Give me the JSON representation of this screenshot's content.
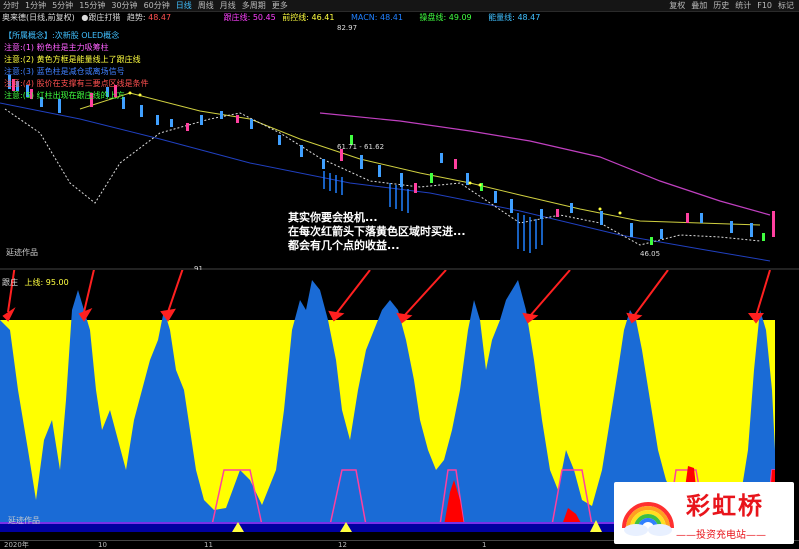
{
  "toolbar": {
    "items": [
      "分时",
      "1分钟",
      "5分钟",
      "15分钟",
      "30分钟",
      "60分钟",
      "日线",
      "周线",
      "月线",
      "多周期",
      "更多"
    ],
    "active": "日线",
    "right": [
      "复权",
      "叠加",
      "历史",
      "统计",
      "F10",
      "标记"
    ]
  },
  "status": {
    "stock": "奥来德(日线,前复权)",
    "follow": "●跟庄打猎",
    "trend_label": "趋势:",
    "trend_value": "48.47",
    "ma_label": "跟庄线:",
    "ma_value": "50.45",
    "pre_label": "前控线:",
    "pre_value": "46.41",
    "macn_label": "MACN:",
    "macn_value": "48.41",
    "kong_label": "操盘线:",
    "kong_value": "49.09",
    "nl_label": "能量线:",
    "nl_value": "48.47"
  },
  "legend": [
    {
      "text": "【所属概念】:次新股 OLED概念",
      "color": "#40c0ff"
    },
    {
      "text": "注意:(1)    粉色柱是主力吸筹柱",
      "color": "#ff60ff"
    },
    {
      "text": "注意:(2)    黄色方框是能量线上了跟庄线",
      "color": "#ffff40"
    },
    {
      "text": "注意:(3)    蓝色柱是减仓或离场信号",
      "color": "#4080ff"
    },
    {
      "text": "注意:(4)    股价在支撑有三要点区线是条件",
      "color": "#ff5050"
    },
    {
      "text": "注意:(5)    红柱出现在跟庄线的上方",
      "color": "#40ff40"
    }
  ],
  "caption": [
    "其实你要会投机...",
    "在每次红箭头下落黄色区域时买进...",
    "都会有几个点的收益..."
  ],
  "labels": {
    "mid": "延迹作品",
    "bottom": "延迹作品",
    "indicator_name": "跟庄",
    "indicator_line": "上线: 95.00",
    "price_high": "82.97",
    "price_a": "61.71 - 61.62",
    "price_b": "46.05",
    "num": "91"
  },
  "axis": [
    "2020年",
    "10",
    "11",
    "12",
    "1"
  ],
  "watermark": {
    "brand": "彩虹桥",
    "sub": "——投资充电站——"
  },
  "colors": {
    "yellow": "#ffff00",
    "blue": "#1a6bd6",
    "red": "#ff0000",
    "magenta": "#ff40a0",
    "navy": "#0000a0"
  }
}
